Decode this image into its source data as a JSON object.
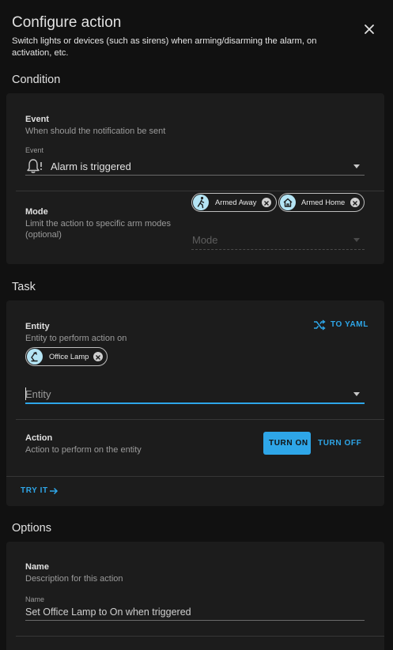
{
  "dialog": {
    "title": "Configure action",
    "subtitle": "Switch lights or devices (such as sirens) when arming/disarming the alarm, on activation, etc.",
    "close_icon": "close-icon"
  },
  "condition": {
    "section_title": "Condition",
    "event": {
      "label": "Event",
      "description": "When should the notification be sent",
      "field_label": "Event",
      "value": "Alarm is triggered",
      "icon": "bell-alert-icon"
    },
    "mode": {
      "label": "Mode",
      "description": "Limit the action to specific arm modes (optional)",
      "chips": [
        {
          "label": "Armed Away",
          "icon": "walk-icon"
        },
        {
          "label": "Armed Home",
          "icon": "home-icon"
        }
      ],
      "placeholder": "Mode"
    }
  },
  "task": {
    "section_title": "Task",
    "entity": {
      "label": "Entity",
      "description": "Entity to perform action on",
      "yaml_button": "TO YAML",
      "chips": [
        {
          "label": "Office Lamp",
          "icon": "desk-lamp-icon"
        }
      ],
      "placeholder": "Entity"
    },
    "action": {
      "label": "Action",
      "description": "Action to perform on the entity",
      "turn_on": "TURN ON",
      "turn_off": "TURN OFF"
    },
    "try_it": "TRY IT"
  },
  "options": {
    "section_title": "Options",
    "name": {
      "label": "Name",
      "description": "Description for this action",
      "field_label": "Name",
      "value": "Set Office Lamp to On when triggered"
    }
  },
  "colors": {
    "accent": "#2ea6e8",
    "card": "#1c1c1c",
    "background": "#111111"
  }
}
